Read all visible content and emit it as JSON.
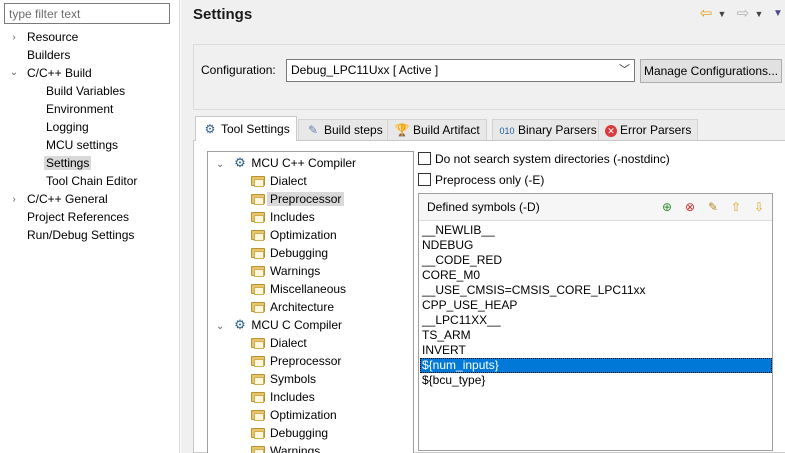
{
  "filter": {
    "placeholder": "type filter text"
  },
  "nav": {
    "items": [
      {
        "label": "Resource",
        "twisty": "›",
        "indent": 0
      },
      {
        "label": "Builders",
        "twisty": "",
        "indent": 0
      },
      {
        "label": "C/C++ Build",
        "twisty": "⌄",
        "indent": 0
      },
      {
        "label": "Build Variables",
        "twisty": "",
        "indent": 1
      },
      {
        "label": "Environment",
        "twisty": "",
        "indent": 1
      },
      {
        "label": "Logging",
        "twisty": "",
        "indent": 1
      },
      {
        "label": "MCU settings",
        "twisty": "",
        "indent": 1
      },
      {
        "label": "Settings",
        "twisty": "",
        "indent": 1,
        "selected": true
      },
      {
        "label": "Tool Chain Editor",
        "twisty": "",
        "indent": 1
      },
      {
        "label": "C/C++ General",
        "twisty": "›",
        "indent": 0
      },
      {
        "label": "Project References",
        "twisty": "",
        "indent": 0
      },
      {
        "label": "Run/Debug Settings",
        "twisty": "",
        "indent": 0
      }
    ]
  },
  "header": {
    "title": "Settings"
  },
  "configuration": {
    "label": "Configuration:",
    "value": "Debug_LPC11Uxx  [ Active ]",
    "manage_label": "Manage Configurations..."
  },
  "tabs": [
    {
      "label": "Tool Settings",
      "icon": "tool-settings-icon",
      "active": true
    },
    {
      "label": "Build steps",
      "icon": "build-steps-icon"
    },
    {
      "label": "Build Artifact",
      "icon": "build-artifact-icon"
    },
    {
      "label": "Binary Parsers",
      "icon": "binary-parsers-icon"
    },
    {
      "label": "Error Parsers",
      "icon": "error-parsers-icon"
    }
  ],
  "tool_tree": {
    "cpp_compiler": {
      "label": "MCU C++ Compiler",
      "children": [
        "Dialect",
        "Preprocessor",
        "Includes",
        "Optimization",
        "Debugging",
        "Warnings",
        "Miscellaneous",
        "Architecture"
      ],
      "selected_index": 1
    },
    "c_compiler": {
      "label": "MCU C Compiler",
      "children": [
        "Dialect",
        "Preprocessor",
        "Symbols",
        "Includes",
        "Optimization",
        "Debugging",
        "Warnings"
      ]
    }
  },
  "options": {
    "nostdinc_label": "Do not search system directories (-nostdinc)",
    "preprocess_only_label": "Preprocess only (-E)"
  },
  "symbols": {
    "title": "Defined symbols (-D)",
    "items": [
      "__NEWLIB__",
      "NDEBUG",
      "__CODE_RED",
      "CORE_M0",
      "__USE_CMSIS=CMSIS_CORE_LPC11xx",
      "CPP_USE_HEAP",
      "__LPC11XX__",
      "TS_ARM",
      "INVERT",
      "${num_inputs}",
      "${bcu_type}"
    ],
    "selected_index": 9
  },
  "colors": {
    "selection": "#0078d7",
    "tree_selection": "#d9d9d9",
    "panel_bg": "#f0f0f0"
  }
}
